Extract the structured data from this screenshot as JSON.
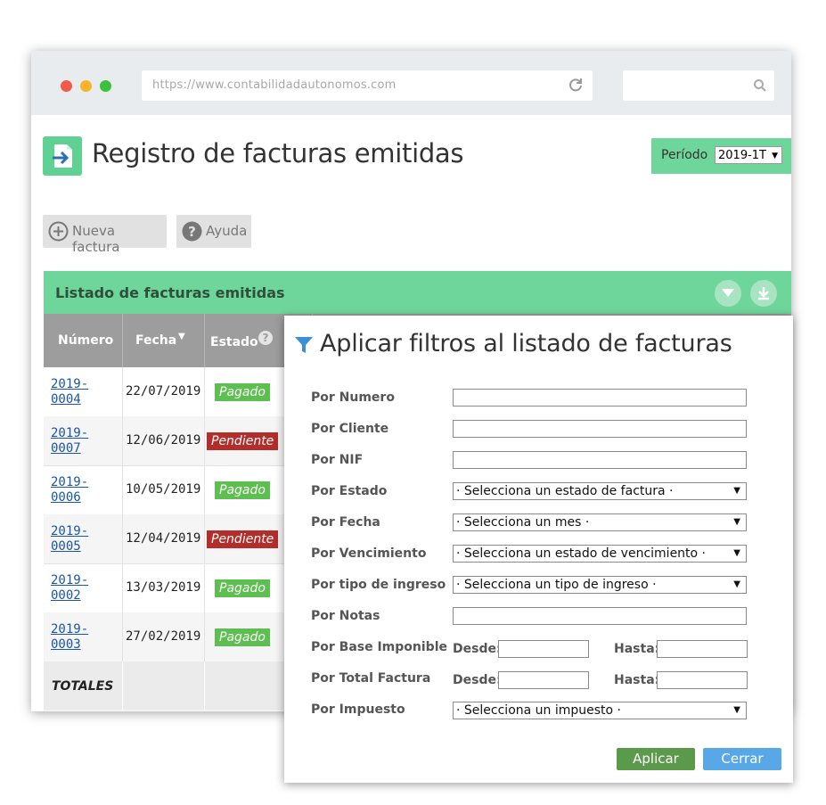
{
  "browser": {
    "url": "https://www.contabilidadautonomos.com"
  },
  "page": {
    "title": "Registro de facturas emitidas",
    "periodo_label": "Período",
    "periodo_value": "2019-1T"
  },
  "toolbar": {
    "nueva_label": "Nueva factura",
    "ayuda_label": "Ayuda"
  },
  "listado": {
    "title": "Listado de facturas emitidas",
    "columns": [
      "Número",
      "Fecha",
      "Estado"
    ],
    "rows": [
      {
        "num_a": "2019-",
        "num_b": "0004",
        "fecha": "22/07/2019",
        "estado": "Pagado"
      },
      {
        "num_a": "2019-",
        "num_b": "0007",
        "fecha": "12/06/2019",
        "estado": "Pendiente"
      },
      {
        "num_a": "2019-",
        "num_b": "0006",
        "fecha": "10/05/2019",
        "estado": "Pagado"
      },
      {
        "num_a": "2019-",
        "num_b": "0005",
        "fecha": "12/04/2019",
        "estado": "Pendiente"
      },
      {
        "num_a": "2019-",
        "num_b": "0002",
        "fecha": "13/03/2019",
        "estado": "Pagado"
      },
      {
        "num_a": "2019-",
        "num_b": "0003",
        "fecha": "27/02/2019",
        "estado": "Pagado"
      }
    ],
    "totales_label": "TOTALES"
  },
  "colors": {
    "accent_green": "#6fd69b",
    "paid": "#5cbf4f",
    "pending": "#b32d2a",
    "link": "#1a55a6"
  },
  "modal": {
    "title": "Aplicar filtros al listado de facturas",
    "labels": {
      "numero": "Por Numero",
      "cliente": "Por Cliente",
      "nif": "Por NIF",
      "estado": "Por Estado",
      "fecha": "Por Fecha",
      "vencimiento": "Por Vencimiento",
      "tipo": "Por tipo de ingreso",
      "notas": "Por Notas",
      "base": "Por Base Imponible",
      "total": "Por Total Factura",
      "impuesto": "Por Impuesto"
    },
    "selects": {
      "estado": "· Selecciona un estado de factura ·",
      "fecha": "· Selecciona un mes ·",
      "vencimiento": "· Selecciona un estado de vencimiento ·",
      "tipo": "· Selecciona un tipo de ingreso ·",
      "impuesto": "· Selecciona un impuesto ·"
    },
    "desde_label": "Desde:",
    "hasta_label": "Hasta:",
    "aplicar_label": "Aplicar",
    "cerrar_label": "Cerrar"
  }
}
